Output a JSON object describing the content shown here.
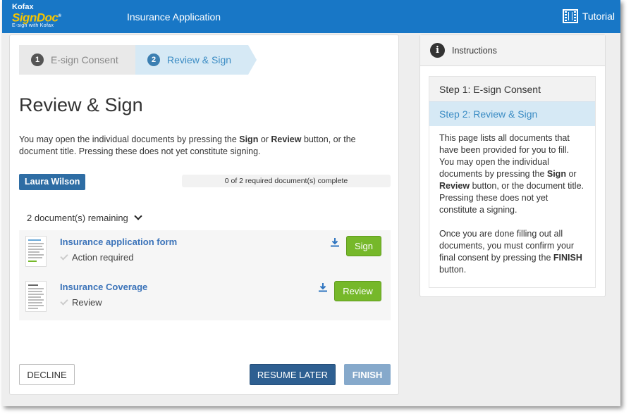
{
  "header": {
    "logo_line1": "Kofax",
    "logo_line2": "SignDoc",
    "logo_line3": "E-sign with Kofax",
    "app_title": "Insurance Application",
    "tutorial_label": "Tutorial"
  },
  "stepper": {
    "steps": [
      {
        "num": "1",
        "label": "E-sign Consent"
      },
      {
        "num": "2",
        "label": "Review & Sign"
      }
    ]
  },
  "main": {
    "title": "Review & Sign",
    "intro": {
      "p1": "You may open the individual documents by pressing the ",
      "b1": "Sign",
      "p2": " or ",
      "b2": "Review",
      "p3": " button, or the document title. Pressing these does not yet constitute signing."
    },
    "signer": "Laura Wilson",
    "progress_text": "0 of 2 required document(s) complete",
    "progress_fraction": 0,
    "remaining_label": "2 document(s) remaining",
    "documents": [
      {
        "title": "Insurance application form",
        "status": "Action required",
        "action": "Sign"
      },
      {
        "title": "Insurance Coverage",
        "status": "Review",
        "action": "Review"
      }
    ],
    "buttons": {
      "decline": "DECLINE",
      "resume": "RESUME LATER",
      "finish": "FINISH"
    }
  },
  "sidebar": {
    "header": "Instructions",
    "steps": [
      {
        "label": "Step 1: E-sign Consent"
      },
      {
        "label": "Step 2: Review & Sign"
      }
    ],
    "text1": {
      "a": "This page lists all documents that have been provided for you to fill. You may open the individual documents by pressing the ",
      "b1": "Sign",
      "c": " or ",
      "b2": "Review",
      "d": " button, or the document title. Pressing these does not yet constitute a signing."
    },
    "text2": {
      "a": "Once you are done filling out all documents, you must confirm your final consent by pressing the ",
      "b": "FINISH",
      "c": " button."
    }
  },
  "colors": {
    "topbar": "#1877c6",
    "accent_green": "#76b82a",
    "accent_blue": "#2e5f91",
    "active_step": "#d6e9f5"
  }
}
